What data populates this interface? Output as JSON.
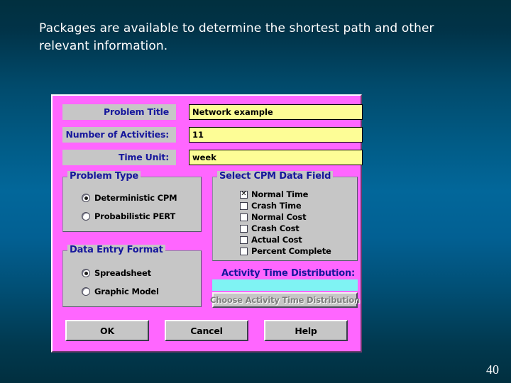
{
  "slide": {
    "body_text": "Packages are available to determine the shortest path and other relevant information.",
    "page_number": "40"
  },
  "dialog": {
    "fields": [
      {
        "label": "Problem Title",
        "value": "Network example"
      },
      {
        "label": "Number of Activities:",
        "value": "11"
      },
      {
        "label": "Time Unit:",
        "value": "week"
      }
    ],
    "problem_type": {
      "title": "Problem Type",
      "options": [
        {
          "label": "Deterministic CPM",
          "selected": true
        },
        {
          "label": "Probabilistic PERT",
          "selected": false
        }
      ]
    },
    "cpm_data_field": {
      "title": "Select CPM Data Field",
      "items": [
        {
          "label": "Normal Time",
          "checked": true,
          "mark": "✕"
        },
        {
          "label": "Crash Time",
          "checked": false,
          "mark": ""
        },
        {
          "label": "Normal Cost",
          "checked": false,
          "mark": ""
        },
        {
          "label": "Crash Cost",
          "checked": false,
          "mark": ""
        },
        {
          "label": "Actual Cost",
          "checked": false,
          "mark": ""
        },
        {
          "label": "Percent Complete",
          "checked": false,
          "mark": ""
        }
      ]
    },
    "data_entry_format": {
      "title": "Data Entry Format",
      "options": [
        {
          "label": "Spreadsheet",
          "selected": true
        },
        {
          "label": "Graphic Model",
          "selected": false
        }
      ]
    },
    "activity_time_distribution": {
      "label": "Activity Time Distribution:",
      "value": "",
      "button_label": "Choose Activity Time Distribution"
    },
    "buttons": {
      "ok": "OK",
      "cancel": "Cancel",
      "help": "Help"
    }
  },
  "colors": {
    "dialog_background": "#ff66ff",
    "control_face": "#c6c6c6",
    "label_text": "#16179c",
    "input_background": "#fdfd96",
    "distribution_field": "#7ff3f3",
    "slide_text": "#ffffff"
  }
}
